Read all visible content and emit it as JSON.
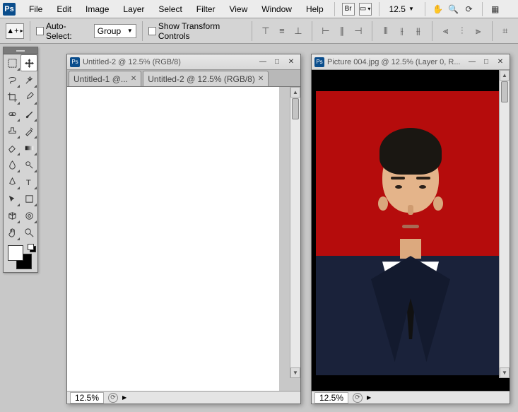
{
  "menubar": {
    "items": [
      "File",
      "Edit",
      "Image",
      "Layer",
      "Select",
      "Filter",
      "View",
      "Window",
      "Help"
    ],
    "bridge_label": "Br",
    "zoom": "12.5"
  },
  "options": {
    "auto_select_label": "Auto-Select:",
    "auto_select_value": "Group",
    "show_transform_label": "Show Transform Controls"
  },
  "windows": {
    "left": {
      "title": "Untitled-2 @ 12.5% (RGB/8)",
      "tabs": [
        {
          "label": "Untitled-1 @...",
          "active": false
        },
        {
          "label": "Untitled-2 @ 12.5% (RGB/8)",
          "active": true
        }
      ],
      "zoom": "12.5%"
    },
    "right": {
      "title": "Picture 004.jpg @ 12.5% (Layer 0, R...",
      "zoom": "12.5%"
    }
  },
  "colors": {
    "brand": "#0a4d8c",
    "portrait_bg": "#b50c0c"
  }
}
